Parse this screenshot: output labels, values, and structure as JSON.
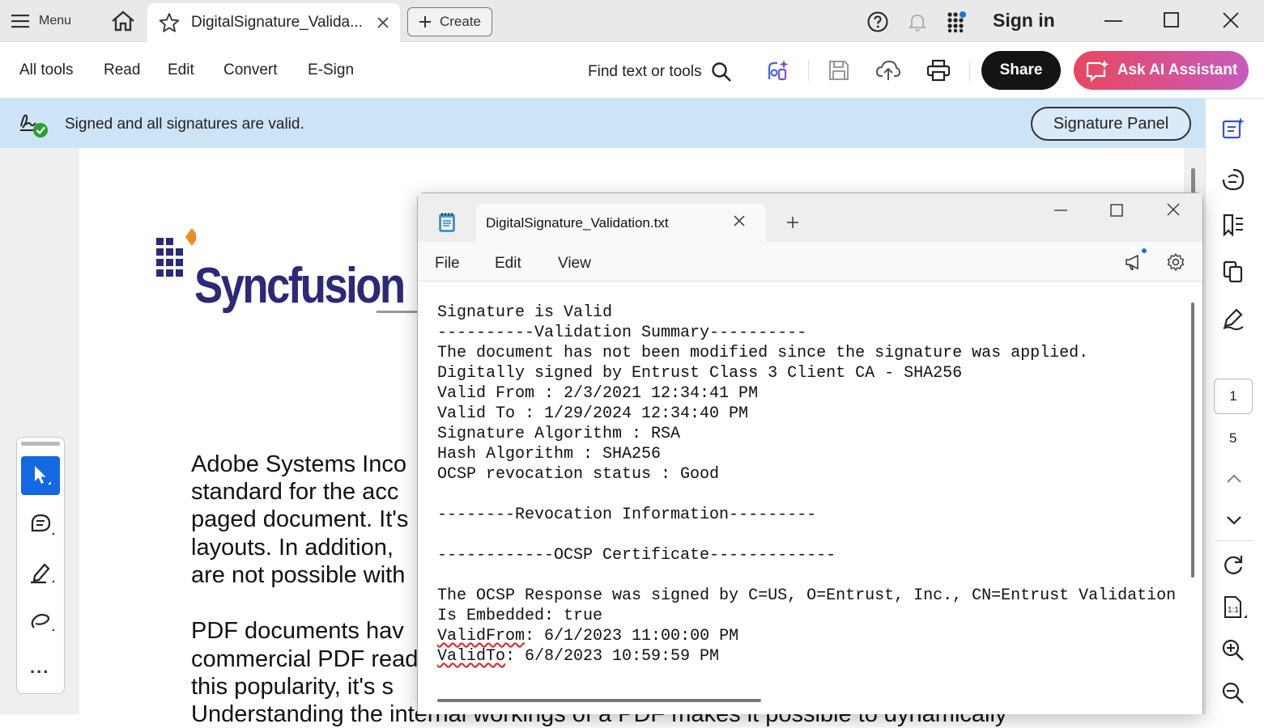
{
  "titlebar": {
    "menu_label": "Menu",
    "tab_title": "DigitalSignature_Valida...",
    "create_label": "Create",
    "signin_label": "Sign in"
  },
  "toolbar": {
    "items": [
      "All tools",
      "Read",
      "Edit",
      "Convert",
      "E-Sign"
    ],
    "find_label": "Find text or tools",
    "share_label": "Share",
    "ai_label": "Ask AI Assistant"
  },
  "signature_bar": {
    "message": "Signed and all signatures are valid.",
    "panel_button": "Signature Panel"
  },
  "document": {
    "logo_text": "Syncfusion",
    "lines": [
      "Adobe Systems Inco",
      "standard for the acc",
      "paged document. It's",
      "layouts. In addition,",
      "are not possible with",
      "PDF documents hav",
      "commercial PDF read",
      "this popularity, it's s",
      "Understanding the internal workings of a PDF makes it possible to dynamically"
    ]
  },
  "palette": {
    "more_label": "..."
  },
  "page_nav": {
    "current": "1",
    "total": "5"
  },
  "notepad": {
    "tab_title": "DigitalSignature_Validation.txt",
    "menu": [
      "File",
      "Edit",
      "View"
    ],
    "lines": [
      "Signature is Valid",
      "----------Validation Summary----------",
      "The document has not been modified since the signature was applied.",
      "Digitally signed by Entrust Class 3 Client CA - SHA256",
      "Valid From : 2/3/2021 12:34:41 PM",
      "Valid To : 1/29/2024 12:34:40 PM",
      "Signature Algorithm : RSA",
      "Hash Algorithm : SHA256",
      "OCSP revocation status : Good",
      "",
      "--------Revocation Information---------",
      "",
      "------------OCSP Certificate-------------",
      "",
      "The OCSP Response was signed by C=US, O=Entrust, Inc., CN=Entrust Validation",
      "Is Embedded: true"
    ],
    "valid_from_key": "ValidFrom",
    "valid_from_value": ": 6/1/2023 11:00:00 PM",
    "valid_to_key": "ValidTo",
    "valid_to_value": ": 6/8/2023 10:59:59 PM"
  }
}
